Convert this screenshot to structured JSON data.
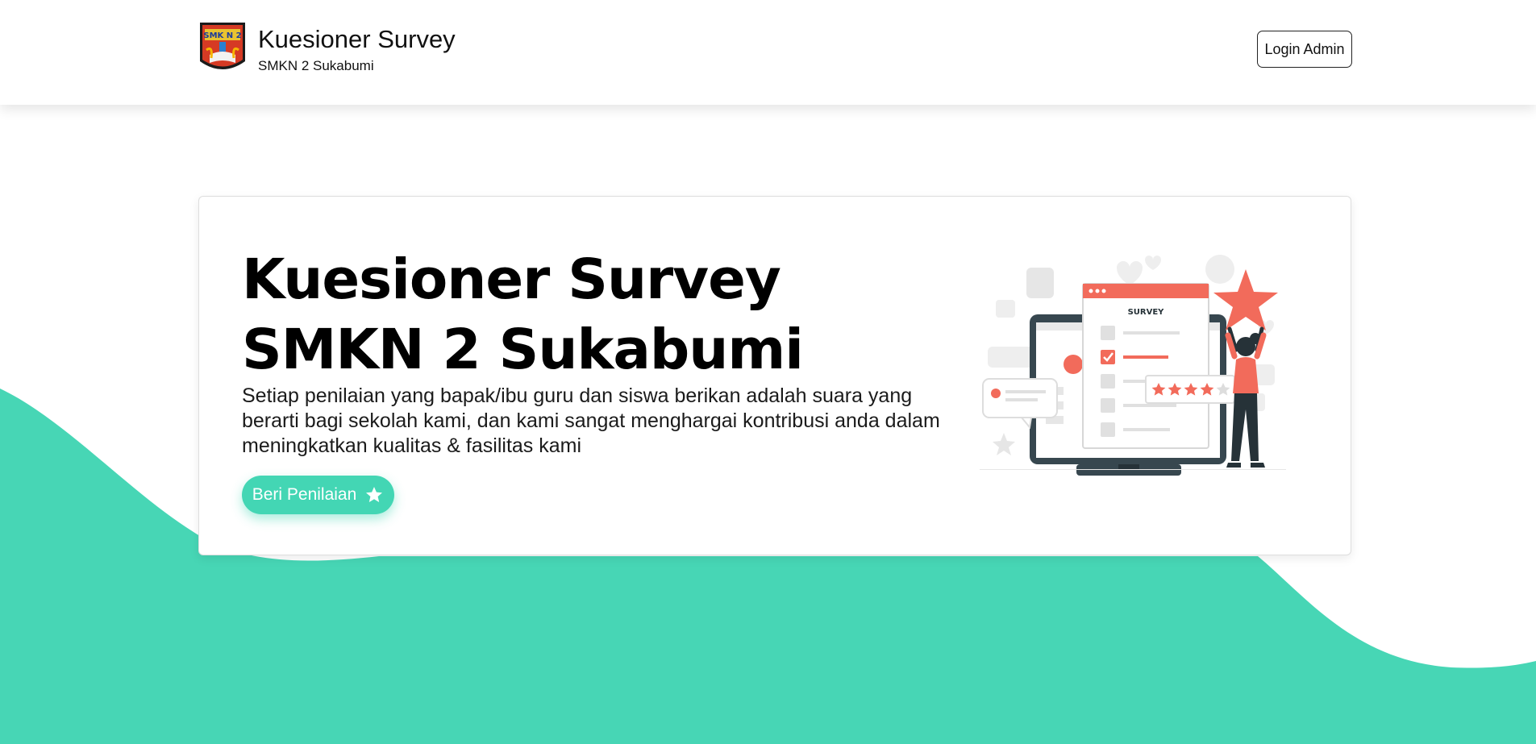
{
  "header": {
    "title": "Kuesioner Survey",
    "subtitle": "SMKN 2 Sukabumi",
    "login_label": "Login Admin",
    "logo_text": "SMK N 2"
  },
  "hero": {
    "title_line1": "Kuesioner Survey",
    "title_line2": "SMKN 2 Sukabumi",
    "description": "Setiap penilaian yang bapak/ibu guru dan siswa berikan adalah suara yang berarti bagi sekolah kami, dan kami sangat menghargai kontribusi anda dalam meningkatkan kualitas & fasilitas kami",
    "cta_label": "Beri Penilaian",
    "cta_icon": "star-icon"
  },
  "illustration": {
    "survey_label": "SURVEY",
    "rating": 4,
    "rating_max": 5
  },
  "colors": {
    "accent": "#43d6b4",
    "illustration_primary": "#f26b5b",
    "illustration_dark": "#37474f"
  }
}
